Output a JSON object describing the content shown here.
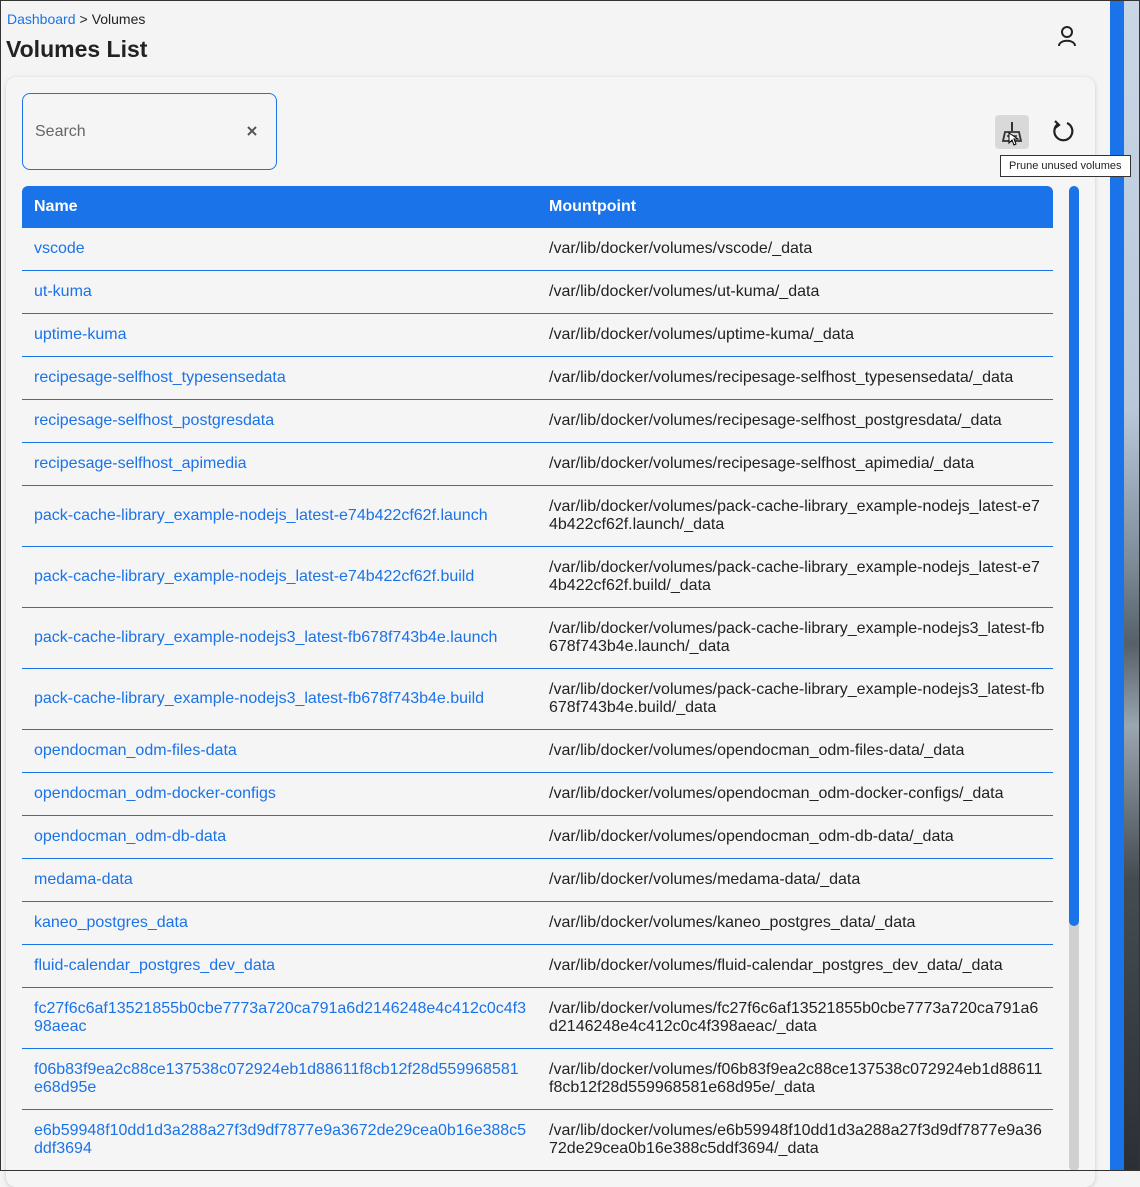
{
  "breadcrumb": {
    "dashboard": "Dashboard",
    "separator": ">",
    "current": "Volumes"
  },
  "page": {
    "title": "Volumes List"
  },
  "search": {
    "placeholder": "Search",
    "value": ""
  },
  "toolbar": {
    "prune_tooltip": "Prune unused volumes"
  },
  "icons": {
    "user": "user-icon",
    "clear": "close-icon",
    "prune": "broom-icon",
    "refresh": "refresh-icon",
    "cursor": "hand-pointer-icon"
  },
  "colors": {
    "accent": "#1a73e8",
    "header_text": "#ffffff"
  },
  "table": {
    "headers": {
      "name": "Name",
      "mountpoint": "Mountpoint"
    },
    "rows": [
      {
        "name": "vscode",
        "mountpoint": "/var/lib/docker/volumes/vscode/_data"
      },
      {
        "name": "ut-kuma",
        "mountpoint": "/var/lib/docker/volumes/ut-kuma/_data"
      },
      {
        "name": "uptime-kuma",
        "mountpoint": "/var/lib/docker/volumes/uptime-kuma/_data"
      },
      {
        "name": "recipesage-selfhost_typesensedata",
        "mountpoint": "/var/lib/docker/volumes/recipesage-selfhost_typesensedata/_data"
      },
      {
        "name": "recipesage-selfhost_postgresdata",
        "mountpoint": "/var/lib/docker/volumes/recipesage-selfhost_postgresdata/_data"
      },
      {
        "name": "recipesage-selfhost_apimedia",
        "mountpoint": "/var/lib/docker/volumes/recipesage-selfhost_apimedia/_data"
      },
      {
        "name": "pack-cache-library_example-nodejs_latest-e74b422cf62f.launch",
        "mountpoint": "/var/lib/docker/volumes/pack-cache-library_example-nodejs_latest-e74b422cf62f.launch/_data"
      },
      {
        "name": "pack-cache-library_example-nodejs_latest-e74b422cf62f.build",
        "mountpoint": "/var/lib/docker/volumes/pack-cache-library_example-nodejs_latest-e74b422cf62f.build/_data"
      },
      {
        "name": "pack-cache-library_example-nodejs3_latest-fb678f743b4e.launch",
        "mountpoint": "/var/lib/docker/volumes/pack-cache-library_example-nodejs3_latest-fb678f743b4e.launch/_data"
      },
      {
        "name": "pack-cache-library_example-nodejs3_latest-fb678f743b4e.build",
        "mountpoint": "/var/lib/docker/volumes/pack-cache-library_example-nodejs3_latest-fb678f743b4e.build/_data"
      },
      {
        "name": "opendocman_odm-files-data",
        "mountpoint": "/var/lib/docker/volumes/opendocman_odm-files-data/_data"
      },
      {
        "name": "opendocman_odm-docker-configs",
        "mountpoint": "/var/lib/docker/volumes/opendocman_odm-docker-configs/_data"
      },
      {
        "name": "opendocman_odm-db-data",
        "mountpoint": "/var/lib/docker/volumes/opendocman_odm-db-data/_data"
      },
      {
        "name": "medama-data",
        "mountpoint": "/var/lib/docker/volumes/medama-data/_data"
      },
      {
        "name": "kaneo_postgres_data",
        "mountpoint": "/var/lib/docker/volumes/kaneo_postgres_data/_data"
      },
      {
        "name": "fluid-calendar_postgres_dev_data",
        "mountpoint": "/var/lib/docker/volumes/fluid-calendar_postgres_dev_data/_data"
      },
      {
        "name": "fc27f6c6af13521855b0cbe7773a720ca791a6d2146248e4c412c0c4f398aeac",
        "mountpoint": "/var/lib/docker/volumes/fc27f6c6af13521855b0cbe7773a720ca791a6d2146248e4c412c0c4f398aeac/_data"
      },
      {
        "name": "f06b83f9ea2c88ce137538c072924eb1d88611f8cb12f28d559968581e68d95e",
        "mountpoint": "/var/lib/docker/volumes/f06b83f9ea2c88ce137538c072924eb1d88611f8cb12f28d559968581e68d95e/_data"
      },
      {
        "name": "e6b59948f10dd1d3a288a27f3d9df7877e9a3672de29cea0b16e388c5ddf3694",
        "mountpoint": "/var/lib/docker/volumes/e6b59948f10dd1d3a288a27f3d9df7877e9a3672de29cea0b16e388c5ddf3694/_data"
      }
    ]
  }
}
